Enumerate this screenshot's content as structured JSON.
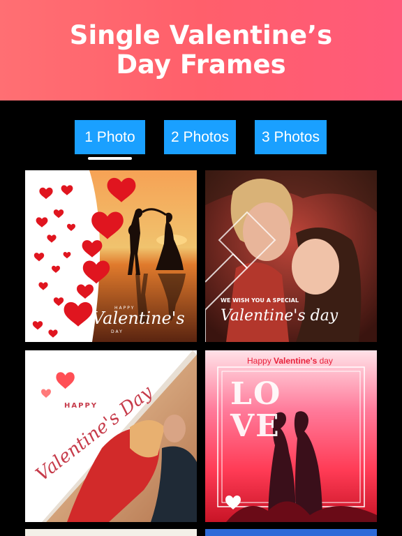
{
  "header": {
    "title": "Single Valentine’s Day Frames"
  },
  "tabs": [
    {
      "label": "1 Photo",
      "selected": true
    },
    {
      "label": "2 Photos",
      "selected": false
    },
    {
      "label": "3 Photos",
      "selected": false
    }
  ],
  "frames": [
    {
      "line1": "HAPPY",
      "line2": "Valentine's",
      "line3": "DAY"
    },
    {
      "line1": "WE WISH YOU A SPECIAL",
      "line2": "Valentine's day"
    },
    {
      "line1": "HAPPY",
      "line2": "Valentine's Day"
    },
    {
      "line1_prefix": "Happy ",
      "line1_strong": "Valentine's",
      "line1_suffix": " day",
      "big_word": "LOVE"
    }
  ],
  "colors": {
    "header": "#ff6470",
    "tab": "#1aa0ff",
    "background": "#000000"
  }
}
